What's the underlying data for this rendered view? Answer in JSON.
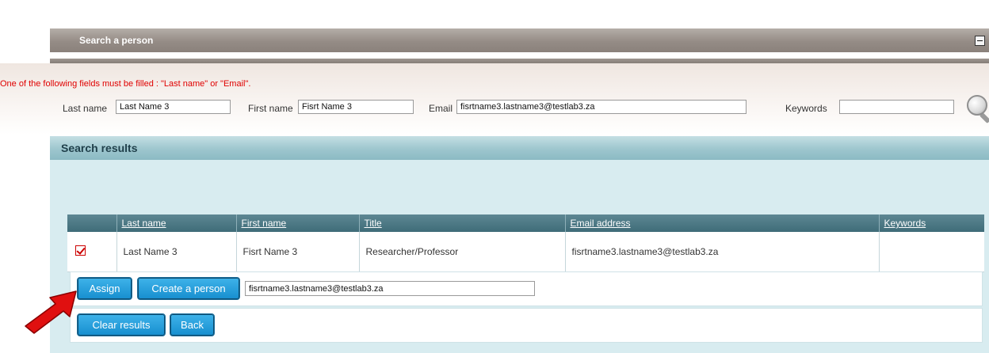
{
  "search_panel": {
    "title": "Search a person",
    "warning": "One of the following fields must be filled : \"Last name\" or \"Email\".",
    "last_name_label": "Last name",
    "last_name_value": "Last Name 3",
    "first_name_label": "First name",
    "first_name_value": "Fisrt Name 3",
    "email_label": "Email",
    "email_value": "fisrtname3.lastname3@testlab3.za",
    "keywords_label": "Keywords",
    "keywords_value": ""
  },
  "results": {
    "title": "Search results",
    "columns": [
      "Last name",
      "First name",
      "Title",
      "Email address",
      "Keywords"
    ],
    "rows": [
      {
        "selected": true,
        "last_name": "Last Name 3",
        "first_name": "Fisrt Name 3",
        "title": "Researcher/Professor",
        "email": "fisrtname3.lastname3@testlab3.za",
        "keywords": ""
      }
    ]
  },
  "actions": {
    "assign_label": "Assign",
    "create_person_label": "Create a person",
    "email_input_value": "fisrtname3.lastname3@testlab3.za",
    "clear_results_label": "Clear results",
    "back_label": "Back"
  },
  "colors": {
    "warning": "#e00000",
    "button": "#168ecf",
    "table_header": "#3f6c78",
    "arrow": "#e01010"
  }
}
